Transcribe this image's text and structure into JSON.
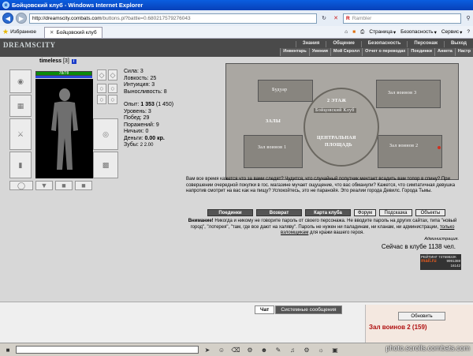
{
  "window": {
    "title": "Бойцовский клуб - Windows Internet Explorer",
    "icon": "ie-logo-icon"
  },
  "address": {
    "url_host": "http://dreamscity.combats.com",
    "url_rest": "/buttons.pl?battle=0.680217579276043",
    "search_placeholder": "Rambler"
  },
  "favorites": {
    "label": "Избранное",
    "tab_title": "Бойцовский клуб"
  },
  "commands": {
    "page": "Страница",
    "safety": "Безопасность",
    "service": "Сервис"
  },
  "game": {
    "logo": "DREAMSCITY",
    "top_menu": [
      "Знания",
      "Общение",
      "Безопасность",
      "Персонаж",
      "Выход"
    ],
    "sub_menu": [
      "Инвентарь",
      "Умения",
      "Мой Скролл",
      "Отчет о переводах",
      "Поединки",
      "Анкета",
      "Настр"
    ]
  },
  "character": {
    "name": "timeless",
    "level": "[3]",
    "hp": "78/78",
    "stats": {
      "strength": "Сила: 3",
      "agility": "Ловкость: 25",
      "intuition": "Интуиция: 3",
      "endurance": "Выносливость: 8"
    },
    "experience_label": "Опыт:",
    "experience_value": "1 353",
    "experience_next": "(1 450)",
    "level_line": "Уровень: 3",
    "wins": "Побед: 29",
    "losses": "Поражений: 9",
    "draws": "Ничьих: 0",
    "money_label": "Деньги:",
    "money_value": "0.00 кр.",
    "teeth": "Зубы: ",
    "teeth_values": "⁢2 ⁢2.00"
  },
  "map": {
    "buduar": "Будуар",
    "floor": "2 ЭТАЖ",
    "club": "Бойцовский Клуб",
    "halls": "ЗАЛЫ",
    "square_line1": "ЦЕНТРАЛЬНАЯ",
    "square_line2": "ПЛОЩАДЬ",
    "hall3": "Зал воинов 3",
    "hall2": "Зал воинов 2",
    "hall1": "Зал воинов 1"
  },
  "description": "Вам все время кажется что за вами следят? Чудится, что случайный попутчик мечтает всадить вам топор в спину? При совершении очередной покупки в гос. магазине мучает ощущение, что вас обманули? Кажется, что симпатичная девушка напротив смотрит на вас как на пищу? Успокойтесь, это не паранойя. Это реалии города Девилс. Города Тьмы.",
  "buttons": {
    "fights": "Поединки",
    "back": "Возврат",
    "club_map": "Карта клуба",
    "forum": "Форум",
    "hint": "Подсказка",
    "ads": "Объекты"
  },
  "warning": {
    "label": "Внимание!",
    "text": "Никогда и никому не говорите пароль от своего персонажа. Не вводите пароль на других сайтах, типа \"новый город\", \"лотерея\", \"там, где все дают на халяву\". Пароль не нужен ни паладинам, ни кланам, ни администрации,",
    "link": "только взломщикам",
    "tail": "для кражи вашего героя."
  },
  "admin": "Администрация.",
  "online": "Сейчас в клубе 1138 чел.",
  "counter": {
    "line1": "РЕЙТИНГ 74769822К",
    "logo": "mail.ru",
    "line2": "9991369",
    "line3": "16142"
  },
  "chat": {
    "tab_chat": "Чат",
    "tab_system": "Системные сообщения"
  },
  "side": {
    "refresh": "Обновить",
    "room": "Зал воинов 2 (159)"
  },
  "watermark": "photo.scrolls.combats.com"
}
